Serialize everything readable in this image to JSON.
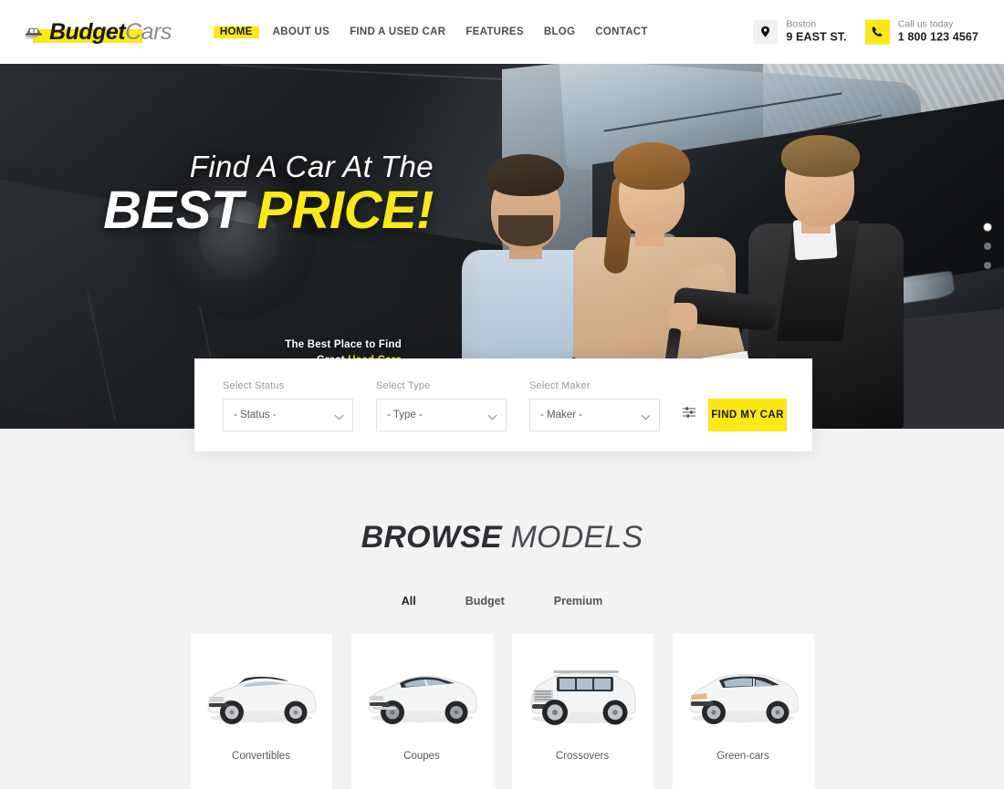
{
  "header": {
    "logo": {
      "icon": "car-logo-icon",
      "primary": "Budget",
      "secondary": "Cars"
    },
    "nav": [
      {
        "label": "HOME",
        "active": true
      },
      {
        "label": "ABOUT US",
        "active": false
      },
      {
        "label": "FIND A USED CAR",
        "active": false
      },
      {
        "label": "FEATURES",
        "active": false
      },
      {
        "label": "BLOG",
        "active": false
      },
      {
        "label": "CONTACT",
        "active": false
      }
    ],
    "contacts": [
      {
        "icon": "location-pin-icon",
        "top": "Boston",
        "bottom": "9 EAST ST.",
        "badge": "grey"
      },
      {
        "icon": "phone-icon",
        "top": "Call us today",
        "bottom": "1 800 123 4567",
        "badge": "yellow"
      }
    ]
  },
  "hero": {
    "headline_line1": "Find A Car At The",
    "headline_best": "BEST ",
    "headline_price": "PRICE!",
    "sub_line1": "The Best Place to Find",
    "sub_line2_plain": "Great ",
    "sub_line2_highlight": "Used Cars",
    "sub_icon": "car-outline-icon",
    "dots": [
      {
        "active": true
      },
      {
        "active": false
      },
      {
        "active": false
      }
    ]
  },
  "search": {
    "fields": [
      {
        "label": "Select Status",
        "value": "- Status -"
      },
      {
        "label": "Select Type",
        "value": "- Type -"
      },
      {
        "label": "Select Maker",
        "value": "- Maker -"
      }
    ],
    "advanced_icon": "filter-sliders-icon",
    "submit_label": "FIND MY CAR"
  },
  "browse": {
    "title_bold": "BROWSE ",
    "title_light": "MODELS",
    "tabs": [
      {
        "label": "All",
        "active": true
      },
      {
        "label": "Budget",
        "active": false
      },
      {
        "label": "Premium",
        "active": false
      }
    ],
    "models": [
      {
        "label": "Convertibles",
        "icon": "convertible-car-image"
      },
      {
        "label": "Coupes",
        "icon": "coupe-car-image"
      },
      {
        "label": "Crossovers",
        "icon": "suv-car-image"
      },
      {
        "label": "Green-cars",
        "icon": "hatchback-car-image"
      }
    ]
  },
  "colors": {
    "accent_yellow": "#FBE816",
    "page_background": "#F3F3F3",
    "text_dark": "#1C1C1F",
    "text_muted": "#86878B"
  }
}
